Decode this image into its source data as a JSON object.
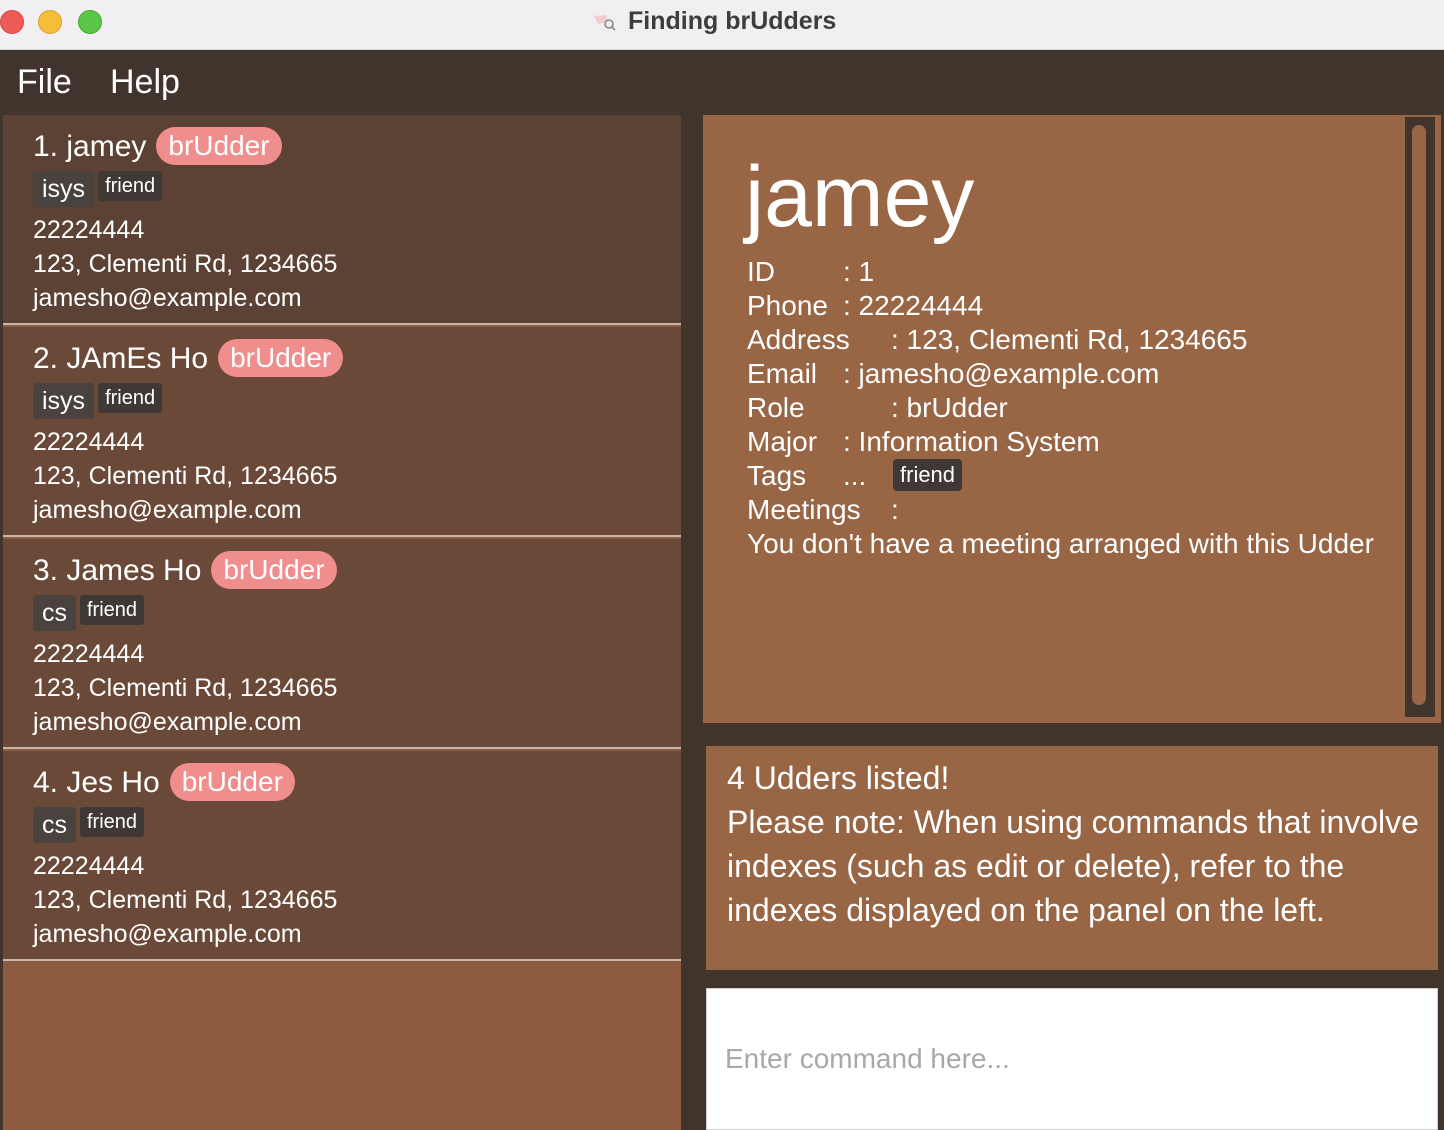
{
  "window": {
    "title": "Finding brUdders"
  },
  "menu": {
    "file": "File",
    "help": "Help"
  },
  "persons": [
    {
      "name": "1. jamey",
      "role": "brUdder",
      "major": "isys",
      "tag": "friend",
      "phone": "22224444",
      "address": "123, Clementi Rd, 1234665",
      "email": "jamesho@example.com"
    },
    {
      "name": "2. JAmEs Ho",
      "role": "brUdder",
      "major": "isys",
      "tag": "friend",
      "phone": "22224444",
      "address": "123, Clementi Rd, 1234665",
      "email": "jamesho@example.com"
    },
    {
      "name": "3. James Ho",
      "role": "brUdder",
      "major": "cs",
      "tag": "friend",
      "phone": "22224444",
      "address": "123, Clementi Rd, 1234665",
      "email": "jamesho@example.com"
    },
    {
      "name": "4. Jes Ho",
      "role": "brUdder",
      "major": "cs",
      "tag": "friend",
      "phone": "22224444",
      "address": "123, Clementi Rd, 1234665",
      "email": "jamesho@example.com"
    }
  ],
  "detail": {
    "name": "jamey",
    "id_label": "ID",
    "id_value": ": 1",
    "phone_label": "Phone",
    "phone_value": ": 22224444",
    "address_label": "Address",
    "address_value": ": 123, Clementi Rd, 1234665",
    "email_label": "Email",
    "email_value": ": jamesho@example.com",
    "role_label": "Role",
    "role_value": ": brUdder",
    "major_label": "Major",
    "major_value": ": Information System",
    "tags_label": "Tags",
    "tags_value": "...",
    "tag": "friend",
    "meetings_label": "Meetings",
    "meetings_value": ":",
    "meeting_note": "You don't have a meeting arranged with this Udder"
  },
  "result": {
    "message": "4 Udders listed!\nPlease note: When using commands that involve indexes (such as edit or delete), refer to the indexes displayed on the panel on the left."
  },
  "command": {
    "placeholder": "Enter command here..."
  },
  "colors": {
    "background": "#41342d",
    "card_selected": "#5c4234",
    "card": "#6a4938",
    "panel": "#986545",
    "role_badge": "#f08d8d"
  }
}
